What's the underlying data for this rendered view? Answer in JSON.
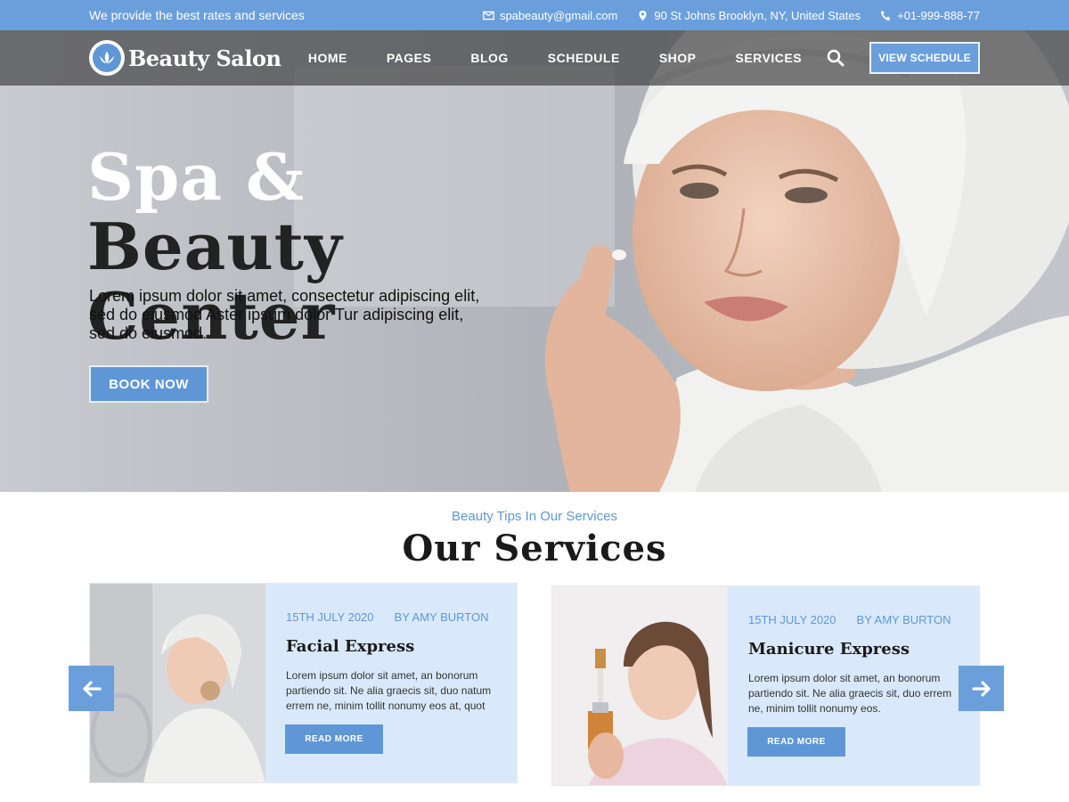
{
  "topbar": {
    "tagline": "We provide the best rates and services",
    "email": "spabeauty@gmail.com",
    "address": "90 St Johns Brooklyn, NY, United States",
    "phone": "+01-999-888-77"
  },
  "header": {
    "logo_text": "Beauty Salon",
    "nav": [
      "HOME",
      "PAGES",
      "BLOG",
      "SCHEDULE",
      "SHOP",
      "SERVICES"
    ],
    "cta_label": "VIEW SCHEDULE"
  },
  "hero": {
    "title_part1": "Spa & ",
    "title_part2": "Beauty",
    "title_line2": "Center",
    "text": "Lorem ipsum dolor sit amet, consectetur adipiscing elit, sed do eiusmod Aster ipsum dolor Tur adipiscing elit, sed do eiusmod.",
    "button_label": "BOOK NOW"
  },
  "services": {
    "subtitle": "Beauty Tips In Our Services",
    "title": "Our Services",
    "cards": [
      {
        "date": "15TH JULY 2020",
        "author": "BY AMY BURTON",
        "title": "Facial Express",
        "text": "Lorem ipsum dolor sit amet, an bonorum partiendo sit. Ne alia graecis sit, duo natum errem ne, minim tollit nonumy eos at, quot",
        "button_label": "READ MORE"
      },
      {
        "date": "15TH JULY 2020",
        "author": "BY AMY BURTON",
        "title": "Manicure Express",
        "text": "Lorem ipsum dolor sit amet, an bonorum partiendo sit. Ne alia graecis sit, duo errem ne, minim tollit nonumy eos.",
        "button_label": "READ MORE"
      }
    ]
  },
  "icons": {
    "email": "mail-icon",
    "address": "map-pin-icon",
    "phone": "phone-icon",
    "search": "search-icon",
    "prev": "arrow-left-icon",
    "next": "arrow-right-icon"
  },
  "colors": {
    "accent": "#6a9fdc",
    "card_bg": "#d9e9fb",
    "header_bg": "#4a4a4c"
  }
}
